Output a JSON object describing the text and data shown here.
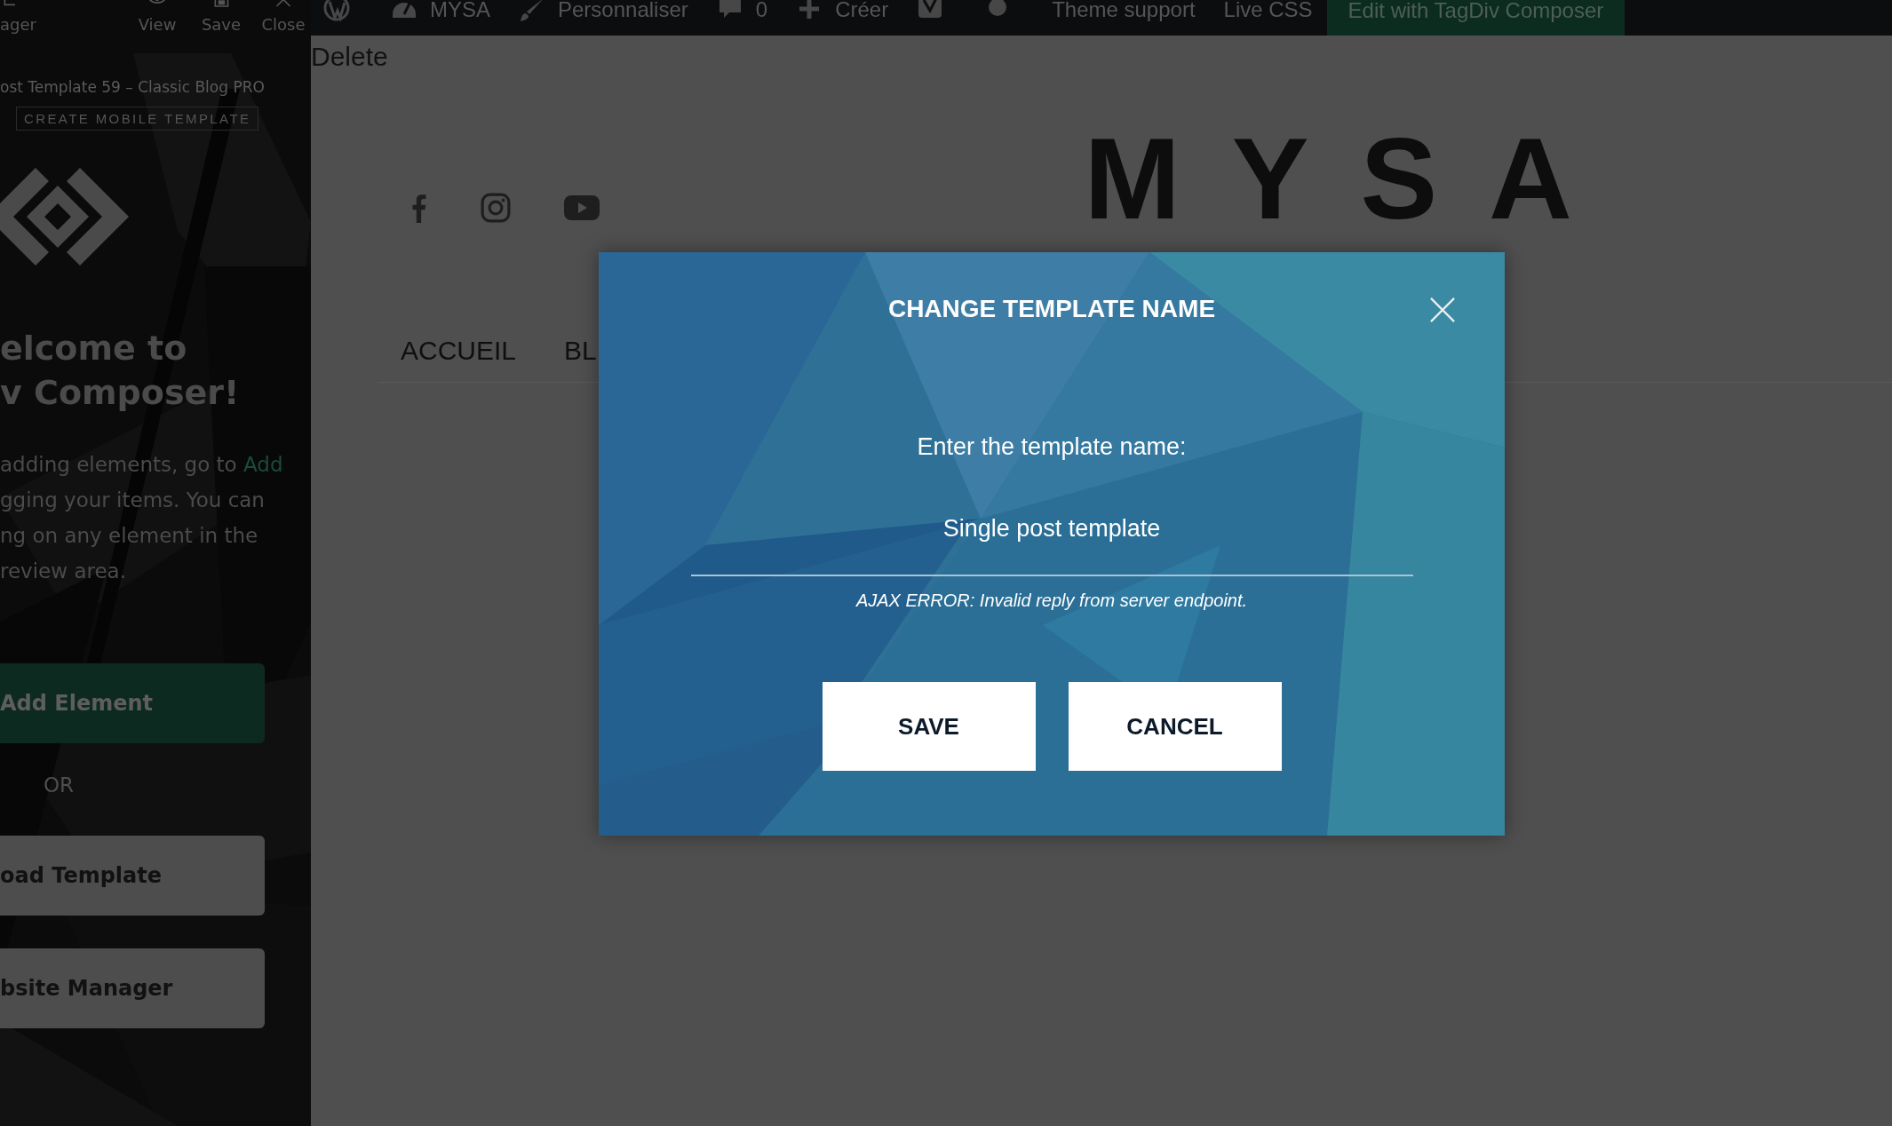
{
  "builder_toolbar": {
    "items": [
      {
        "kind": "manager",
        "label": "ager"
      },
      {
        "kind": "view",
        "label": "View"
      },
      {
        "kind": "save",
        "label": "Save"
      },
      {
        "kind": "close",
        "label": "Close"
      }
    ]
  },
  "sidebar": {
    "template_title": "ost Template 59 – Classic Blog PRO",
    "mobile_template_button": "CREATE MOBILE TEMPLATE",
    "welcome_lines": [
      "elcome to",
      "v Composer!"
    ],
    "intro_lines": [
      {
        "text": "adding elements, go to ",
        "link": "Add"
      },
      {
        "text": "gging your items. You can"
      },
      {
        "text": "ng on any element in the"
      },
      {
        "text": "review area."
      }
    ],
    "add_element_button": "Add Element",
    "or_label": "OR",
    "load_template_button": "oad Template",
    "website_manager_button": "bsite Manager"
  },
  "admin_bar": {
    "items": [
      {
        "kind": "wordpress"
      },
      {
        "kind": "dashboard",
        "label": "MYSA"
      },
      {
        "kind": "brush",
        "label": "Personnaliser"
      },
      {
        "kind": "comment",
        "label": "0"
      },
      {
        "kind": "plus",
        "label": "Créer"
      },
      {
        "kind": "yoast"
      },
      {
        "kind": "dot"
      },
      {
        "kind": "text",
        "label": "Theme support"
      },
      {
        "kind": "text",
        "label": "Live CSS"
      }
    ],
    "composer_button": "Edit with TagDiv Composer"
  },
  "page": {
    "delete_link": "Delete",
    "social": [
      {
        "kind": "facebook"
      },
      {
        "kind": "instagram"
      },
      {
        "kind": "youtube"
      }
    ],
    "logo": "MYSA",
    "nav": [
      "ACCUEIL",
      "BL"
    ]
  },
  "modal": {
    "title": "CHANGE TEMPLATE NAME",
    "label": "Enter the template name:",
    "value": "Single post template",
    "error": "AJAX ERROR: Invalid reply from server endpoint.",
    "buttons": [
      {
        "label": "SAVE"
      },
      {
        "label": "CANCEL"
      }
    ]
  }
}
